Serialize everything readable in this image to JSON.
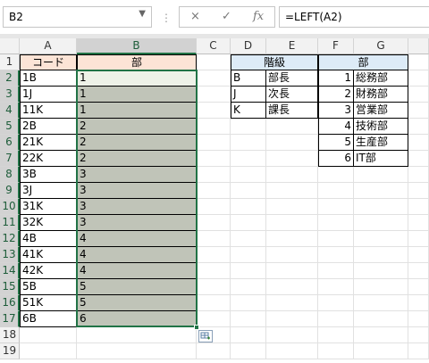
{
  "formula_bar": {
    "name_box": "B2",
    "formula": "=LEFT(A2)",
    "cancel_icon": "×",
    "enter_icon": "✓",
    "fx_icon": "fx"
  },
  "columns": [
    "A",
    "B",
    "C",
    "D",
    "E",
    "F",
    "G"
  ],
  "rows": [
    "1",
    "2",
    "3",
    "4",
    "5",
    "6",
    "7",
    "8",
    "9",
    "10",
    "11",
    "12",
    "13",
    "14",
    "15",
    "16",
    "17",
    "18",
    "19"
  ],
  "table_main": {
    "header_code": "コード",
    "header_dept": "部",
    "codes": [
      "1B",
      "1J",
      "11K",
      "2B",
      "21K",
      "22K",
      "3B",
      "3J",
      "31K",
      "32K",
      "4B",
      "41K",
      "42K",
      "5B",
      "51K",
      "6B"
    ],
    "depts": [
      "1",
      "1",
      "1",
      "2",
      "2",
      "2",
      "3",
      "3",
      "3",
      "3",
      "4",
      "4",
      "4",
      "5",
      "5",
      "6"
    ]
  },
  "table_rank": {
    "header": "階級",
    "rows": [
      {
        "key": "B",
        "value": "部長"
      },
      {
        "key": "J",
        "value": "次長"
      },
      {
        "key": "K",
        "value": "課長"
      }
    ]
  },
  "table_dept": {
    "header": "部",
    "rows": [
      {
        "num": "1",
        "name": "総務部"
      },
      {
        "num": "2",
        "name": "財務部"
      },
      {
        "num": "3",
        "name": "営業部"
      },
      {
        "num": "4",
        "name": "技術部"
      },
      {
        "num": "5",
        "name": "生産部"
      },
      {
        "num": "6",
        "name": "IT部"
      }
    ]
  },
  "colors": {
    "header_fill_orange": "#fce4d6",
    "header_fill_blue": "#ddebf7",
    "selection_fill": "#c0c4b8",
    "selection_border": "#217346"
  },
  "quick_analysis_icon": "quick-analysis"
}
